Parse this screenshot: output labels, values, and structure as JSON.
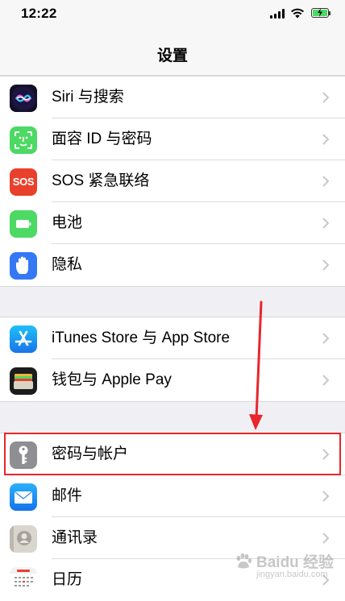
{
  "status_bar": {
    "time": "12:22"
  },
  "nav": {
    "title": "设置"
  },
  "groups": [
    {
      "rows": [
        {
          "label": "Siri 与搜索",
          "icon": "siri-icon"
        },
        {
          "label": "面容 ID 与密码",
          "icon": "face-id-icon"
        },
        {
          "label": "SOS 紧急联络",
          "icon": "sos-icon",
          "icon_text": "SOS"
        },
        {
          "label": "电池",
          "icon": "battery-icon"
        },
        {
          "label": "隐私",
          "icon": "privacy-hand-icon"
        }
      ]
    },
    {
      "rows": [
        {
          "label": "iTunes Store 与 App Store",
          "icon": "app-store-icon"
        },
        {
          "label": "钱包与 Apple Pay",
          "icon": "wallet-icon"
        }
      ]
    },
    {
      "rows": [
        {
          "label": "密码与帐户",
          "icon": "key-icon"
        },
        {
          "label": "邮件",
          "icon": "mail-icon"
        },
        {
          "label": "通讯录",
          "icon": "contacts-icon"
        },
        {
          "label": "日历",
          "icon": "calendar-icon"
        }
      ]
    }
  ],
  "watermark": {
    "main": "Baidu 经验",
    "sub": "jingyan.baidu.com"
  },
  "colors": {
    "highlight": "#e8262b",
    "background": "#efeff4",
    "chevron": "#c7c7cc"
  }
}
